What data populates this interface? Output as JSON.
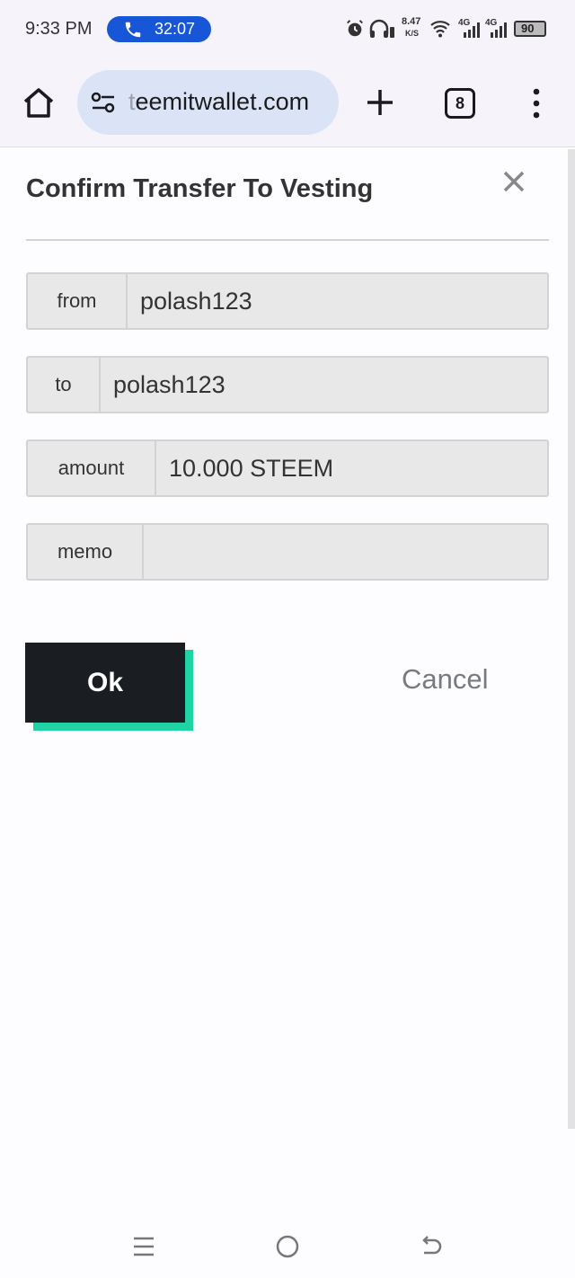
{
  "status_bar": {
    "time": "9:33 PM",
    "call_duration": "32:07",
    "net_speed_value": "8.47",
    "net_speed_unit": "K/S",
    "signal_1_label": "4G",
    "signal_2_label": "4G",
    "battery_level": "90"
  },
  "browser": {
    "url_fade_prefix": "t",
    "url_text": "eemitwallet.com",
    "tab_count": "8"
  },
  "dialog": {
    "title": "Confirm Transfer To Vesting",
    "fields": [
      {
        "label": "from",
        "value": "polash123"
      },
      {
        "label": "to",
        "value": "polash123"
      },
      {
        "label": "amount",
        "value": "10.000 STEEM"
      },
      {
        "label": "memo",
        "value": ""
      }
    ],
    "ok_label": "Ok",
    "cancel_label": "Cancel"
  },
  "colors": {
    "ok_button_bg": "#1a1e23",
    "ok_button_accent": "#1fd3a5",
    "call_pill": "#1756d6",
    "url_pill": "#dbe3f6"
  }
}
